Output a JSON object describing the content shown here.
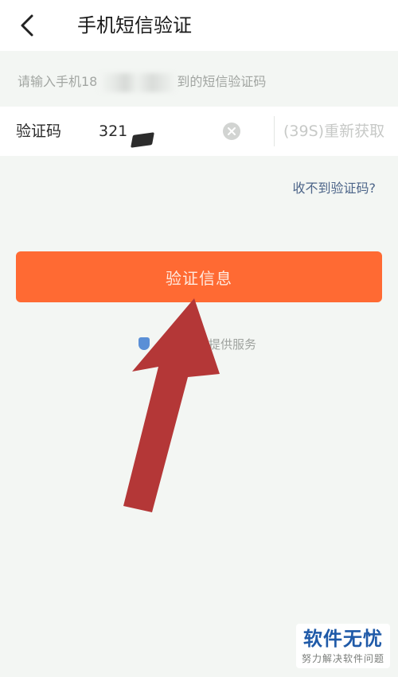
{
  "header": {
    "back_icon": "chevron-left-icon",
    "title": "手机短信验证"
  },
  "hint": {
    "prefix": "请输入手机18",
    "suffix": "到的短信验证码"
  },
  "code_row": {
    "label": "验证码",
    "value": "321",
    "clear_icon": "clear-circle-icon",
    "resend": "(39S)重新获取"
  },
  "no_code_link": "收不到验证码?",
  "verify_button": "验证信息",
  "service_text": "提供服务",
  "annotation": {
    "icon": "red-arrow-icon",
    "color": "#b43737"
  },
  "colors": {
    "accent": "#ff6a33",
    "background": "#f3f6f3",
    "link": "#4d6589",
    "watermark": "#1f5aa8"
  },
  "watermark": {
    "title": "软件无忧",
    "subtitle": "努力解决软件问题"
  }
}
